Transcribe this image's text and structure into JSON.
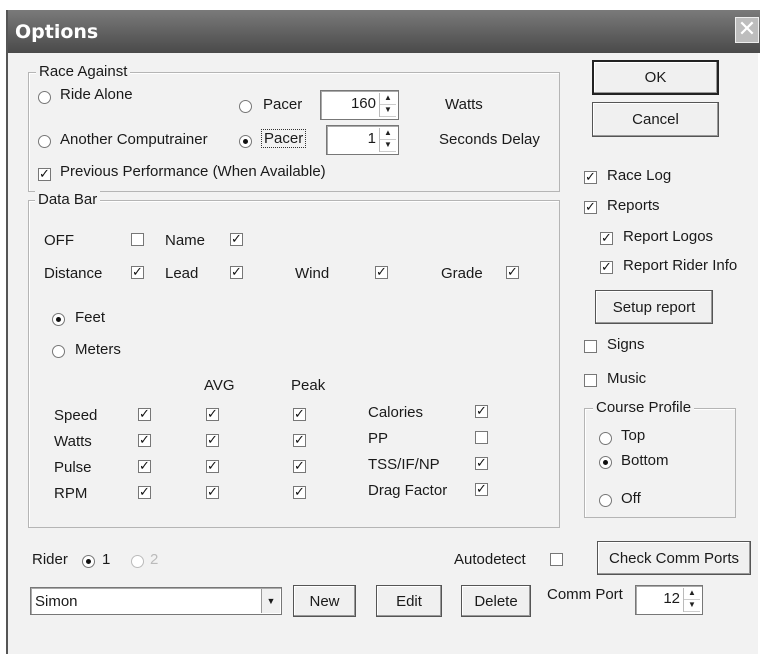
{
  "title": "Options",
  "race_against": {
    "legend": "Race Against",
    "ride_alone": "Ride Alone",
    "pacer_watts": "Pacer",
    "watts_value": "160",
    "watts_unit": "Watts",
    "another_computrainer": "Another Computrainer",
    "pacer_delay": "Pacer",
    "delay_value": "1",
    "delay_unit": "Seconds Delay",
    "previous_performance": "Previous Performance (When Available)"
  },
  "buttons": {
    "ok": "OK",
    "cancel": "Cancel",
    "setup_report": "Setup report",
    "check_comm_ports": "Check Comm Ports",
    "new": "New",
    "edit": "Edit",
    "delete": "Delete"
  },
  "side_options": {
    "race_log": "Race Log",
    "reports": "Reports",
    "report_logos": "Report Logos",
    "report_rider_info": "Report Rider Info",
    "signs": "Signs",
    "music": "Music"
  },
  "course_profile": {
    "legend": "Course Profile",
    "top": "Top",
    "bottom": "Bottom",
    "off": "Off"
  },
  "data_bar": {
    "legend": "Data Bar",
    "off": "OFF",
    "name": "Name",
    "distance": "Distance",
    "lead": "Lead",
    "wind": "Wind",
    "grade": "Grade",
    "feet": "Feet",
    "meters": "Meters",
    "avg_header": "AVG",
    "peak_header": "Peak",
    "rows": [
      {
        "label": "Speed",
        "checked": true,
        "avg": true,
        "peak": true
      },
      {
        "label": "Watts",
        "checked": true,
        "avg": true,
        "peak": true
      },
      {
        "label": "Pulse",
        "checked": true,
        "avg": true,
        "peak": true
      },
      {
        "label": "RPM",
        "checked": true,
        "avg": true,
        "peak": true
      }
    ],
    "extra": [
      {
        "label": "Calories",
        "checked": true
      },
      {
        "label": "PP",
        "checked": false
      },
      {
        "label": "TSS/IF/NP",
        "checked": true
      },
      {
        "label": "Drag Factor",
        "checked": true
      }
    ]
  },
  "rider": {
    "label": "Rider",
    "one": "1",
    "two": "2",
    "selected_name": "Simon"
  },
  "autodetect": "Autodetect",
  "comm_port": {
    "label": "Comm Port",
    "value": "12"
  }
}
